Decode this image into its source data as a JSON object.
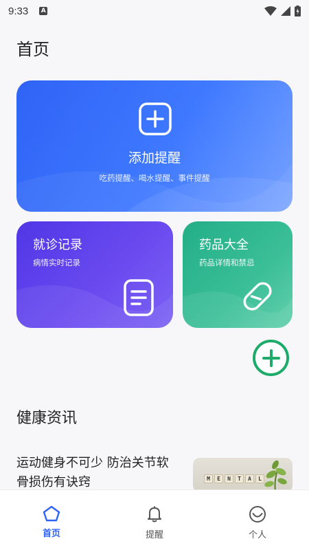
{
  "status_bar": {
    "time": "9:33",
    "notification_badge": "A"
  },
  "page": {
    "title": "首页"
  },
  "cards": {
    "add_reminder": {
      "title": "添加提醒",
      "subtitle": "吃药提醒、喝水提醒、事件提醒"
    },
    "visit_record": {
      "title": "就诊记录",
      "subtitle": "病情实时记录"
    },
    "medicine_guide": {
      "title": "药品大全",
      "subtitle": "药品详情和禁忌"
    }
  },
  "health_news": {
    "section_title": "健康资讯",
    "items": [
      {
        "title": "运动健身不可少 防治关节软骨损伤有诀窍",
        "thumb_text": "MENTAL"
      }
    ]
  },
  "tabbar": {
    "items": [
      {
        "label": "首页",
        "icon": "home-icon",
        "active": true
      },
      {
        "label": "提醒",
        "icon": "bell-icon",
        "active": false
      },
      {
        "label": "个人",
        "icon": "smile-icon",
        "active": false
      }
    ]
  },
  "colors": {
    "primary": "#2f63f5",
    "record_card": "#5a3ee8",
    "medicine_card": "#2db48d",
    "fab_green": "#1dab6a"
  }
}
